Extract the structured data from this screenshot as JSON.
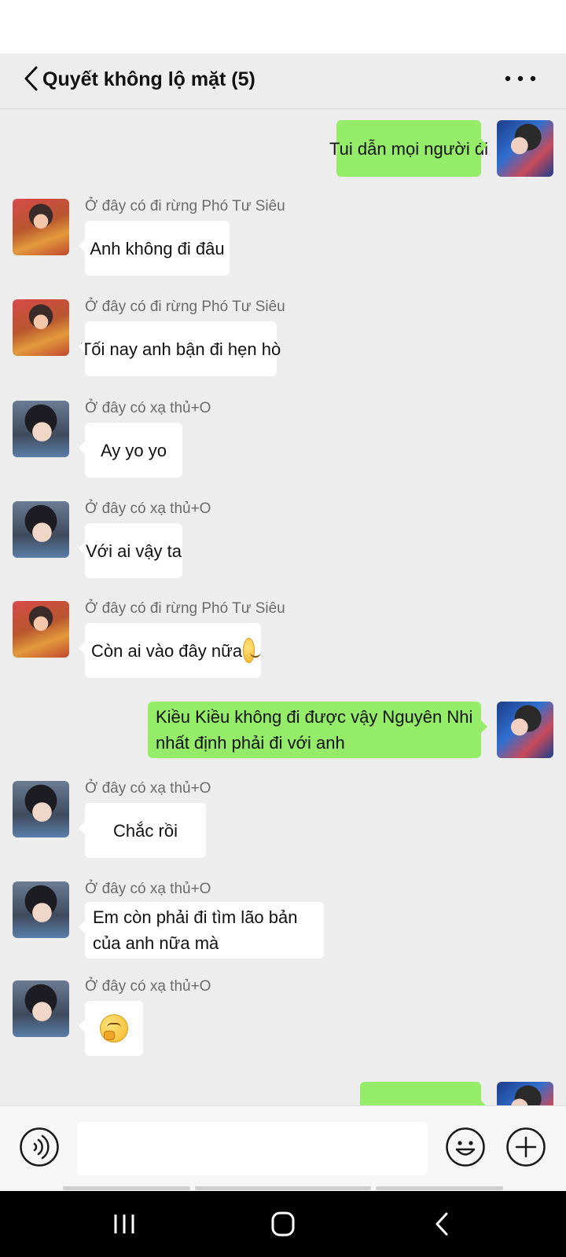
{
  "header": {
    "title": "Quyết không lộ mặt (5)"
  },
  "messages": [
    {
      "side": "out",
      "text": "Tui dẫn mọi người đi"
    },
    {
      "side": "in",
      "sender": "Ở đây có đi rừng Phó Tư Siêu",
      "text": "Anh không đi đâu"
    },
    {
      "side": "in",
      "sender": "Ở đây có đi rừng Phó Tư Siêu",
      "text": "Tối nay anh bận đi hẹn hò"
    },
    {
      "side": "in",
      "sender": "Ở đây có xạ thủ+O",
      "text": "Ay yo yo"
    },
    {
      "side": "in",
      "sender": "Ở đây có xạ thủ+O",
      "text": "Với ai vậy ta"
    },
    {
      "side": "in",
      "sender": "Ở đây có đi rừng Phó Tư Siêu",
      "text": "Còn ai vào đây nữa"
    },
    {
      "side": "out",
      "text": "Kiều Kiều không đi được vậy Nguyên Nhi nhất định phải đi với anh"
    },
    {
      "side": "in",
      "sender": "Ở đây có xạ thủ+O",
      "text": "Chắc rồi"
    },
    {
      "side": "in",
      "sender": "Ở đây có xạ thủ+O",
      "text": "Em còn phải đi tìm lão bản của anh nữa mà"
    },
    {
      "side": "in",
      "sender": "Ở đây có xạ thủ+O",
      "emoji": "thinking-face-emoji"
    }
  ],
  "input": {
    "value": ""
  },
  "icons": {
    "back": "chevron-left-icon",
    "more": "more-dots-icon",
    "voice": "voice-icon",
    "emoji": "emoji-icon",
    "plus": "plus-circle-icon",
    "nav_recent": "recent-apps-icon",
    "nav_home": "home-icon",
    "nav_back": "nav-back-icon"
  },
  "colors": {
    "outgoing_bubble": "#95ec69",
    "incoming_bubble": "#ffffff",
    "chat_background": "#ededed"
  }
}
